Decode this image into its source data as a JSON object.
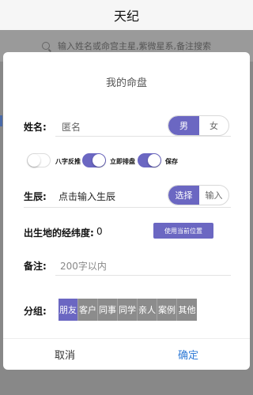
{
  "app": {
    "title": "天纪"
  },
  "search": {
    "placeholder": "输入姓名或命宫主星,紫微星系,备注搜索"
  },
  "dialog": {
    "title": "我的命盘",
    "name": {
      "label": "姓名:",
      "placeholder": "匿名"
    },
    "gender": {
      "options": [
        "男",
        "女"
      ],
      "selected": "男"
    },
    "toggles": [
      {
        "label": "八字反推",
        "on": false
      },
      {
        "label": "立即排盘",
        "on": true
      },
      {
        "label": "保存",
        "on": true
      }
    ],
    "birth": {
      "label": "生辰:",
      "placeholder": "点击输入生辰",
      "modes": [
        "选择",
        "输入"
      ],
      "selected": "选择"
    },
    "location": {
      "label": "出生地的经纬度:",
      "value": "0",
      "button": "使用当前位置"
    },
    "remark": {
      "label": "备注:",
      "placeholder": "200字以内"
    },
    "group": {
      "label": "分组:",
      "options": [
        "朋友",
        "客户",
        "同事",
        "同学",
        "亲人",
        "案例",
        "其他"
      ],
      "selected": "朋友"
    },
    "footer": {
      "cancel": "取消",
      "confirm": "确定"
    }
  },
  "colors": {
    "accent": "#6b67c2",
    "confirm": "#2f7ad6",
    "tag_inactive": "#8c8c8c"
  }
}
